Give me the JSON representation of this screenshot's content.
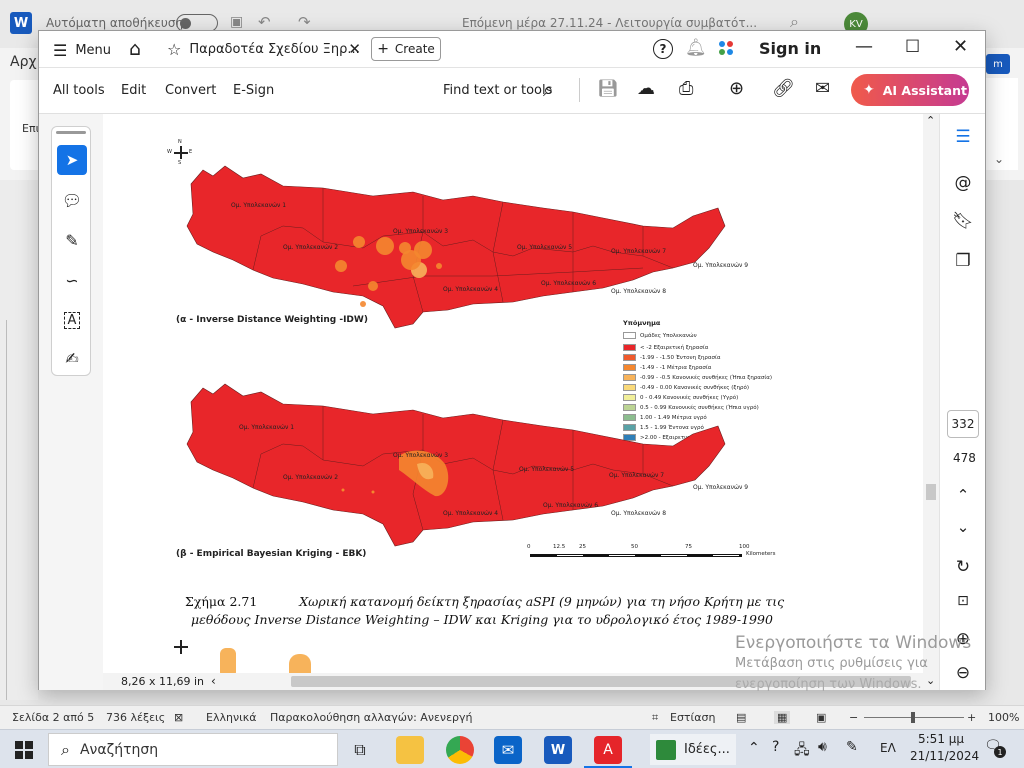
{
  "word": {
    "autosave_label": "Αυτόματη αποθήκευση",
    "doc_title": "Επόμενη μέρα  27.11.24  -  Λειτουργία συμβατότ...",
    "user_initials": "KV",
    "ribbon_file_tab": "Αρχ",
    "ribbon_paste_label": "Επι",
    "status": {
      "page": "Σελίδα 2 από 5",
      "words": "736 λέξεις",
      "language": "Ελληνικά",
      "track_changes": "Παρακολούθηση αλλαγών: Ανενεργή",
      "focus": "Εστίαση",
      "zoom": "100%"
    }
  },
  "acrobat": {
    "menu_label": "Menu",
    "tab_title": "Παραδοτέα Σχεδίου Ξηρ...",
    "create_label": "Create",
    "sign_in": "Sign in",
    "toolbar": {
      "all_tools": "All tools",
      "edit": "Edit",
      "convert": "Convert",
      "esign": "E-Sign",
      "find": "Find text or tools",
      "ai_assistant": "AI Assistant"
    },
    "page_current": "332",
    "page_total": "478",
    "page_size": "8,26 x 11,69 in"
  },
  "document": {
    "map_a_caption": "(α - Inverse Distance Weighting -IDW)",
    "map_b_caption": "(β - Empirical Bayesian Kriging - EBK)",
    "figure_label": "Σχήμα 2.71",
    "figure_caption_line1": "Χωρική κατανομή δείκτη ξηρασίας aSPI (9 μηνών) για τη νήσο Κρήτη με τις",
    "figure_caption_line2": "μεθόδους Inverse Distance Weighting – IDW και Kriging για το υδρολογικό έτος 1989-1990",
    "map_labels": {
      "g1": "Ομ. Υπολεκανών 1",
      "g2": "Ομ. Υπολεκανών 2",
      "g3": "Ομ. Υπολεκανών 3",
      "g4": "Ομ. Υπολεκανών 4",
      "g5": "Ομ. Υπολεκανών 5",
      "g6": "Ομ. Υπολεκανών 6",
      "g7": "Ομ. Υπολεκανών 7",
      "g8": "Ομ. Υπολεκανών 8",
      "g9": "Ομ. Υπολεκανών 9"
    },
    "legend": {
      "title": "Υπόμνημα",
      "boundary": "Ομάδες Υπολεκανών",
      "items": [
        {
          "label": "< -2 Εξαιρετική ξηρασία",
          "color": "#e8262a"
        },
        {
          "label": "-1.99 - -1.50 Έντονη ξηρασία",
          "color": "#ef5a2c"
        },
        {
          "label": "-1.49 - -1 Μέτρια ξηρασία",
          "color": "#f4872f"
        },
        {
          "label": "-0.99 - -0.5 Κανονικές συνθήκες (Ήπια ξηρασία)",
          "color": "#f7b35b"
        },
        {
          "label": "-0.49 - 0.00 Κανονικές συνθήκες (ξηρό)",
          "color": "#f9d97a"
        },
        {
          "label": "0 - 0.49 Κανονικές συνθήκες (Υγρό)",
          "color": "#f1ef9a"
        },
        {
          "label": "0.5 - 0.99 Κανονικές συνθήκες (Ήπια υγρό)",
          "color": "#bcd494"
        },
        {
          "label": "1.00 - 1.49 Μέτρια υγρό",
          "color": "#8cbd8f"
        },
        {
          "label": "1.5 - 1.99 Έντονα υγρό",
          "color": "#5aa2a6"
        },
        {
          "label": ">2.00 - Εξαιρετικά υγρό",
          "color": "#2f7fb8"
        }
      ]
    },
    "scale": {
      "ticks": [
        "0",
        "12.5",
        "25",
        "50",
        "75",
        "100"
      ],
      "unit": "Kilometers"
    },
    "north": {
      "n": "N",
      "s": "S",
      "e": "E",
      "w": "W"
    }
  },
  "windows": {
    "activate_title": "Ενεργοποιήστε τα Windows",
    "activate_sub1": "Μετάβαση στις ρυθμίσεις για",
    "activate_sub2": "ενεργοποίηση των Windows.",
    "search_label": "Αναζήτηση",
    "taskbar_app_label": "Ιδέες...",
    "language": "ΕΛ",
    "time": "5:51 μμ",
    "date": "21/11/2024",
    "notifications": "1"
  },
  "colors": {
    "acrobat_red": "#e5252a",
    "map_red": "#e8262a",
    "ai_gradient_start": "#f05a4a",
    "ai_gradient_end": "#c53a92",
    "word_blue": "#185abd"
  }
}
